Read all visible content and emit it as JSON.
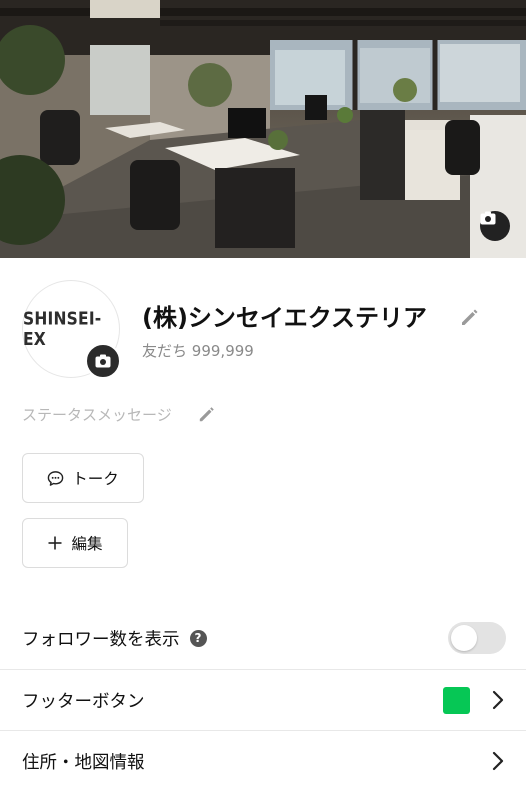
{
  "profile": {
    "name": "(株)シンセイエクステリア",
    "friends_label": "友だち",
    "friends_count": "999,999",
    "logo_text": "SHINSEI-EX",
    "status_placeholder": "ステータスメッセージ"
  },
  "actions": {
    "talk_label": "トーク",
    "edit_label": "編集"
  },
  "settings": {
    "follower_count_label": "フォロワー数を表示",
    "follower_count_enabled": false,
    "footer_button_label": "フッターボタン",
    "footer_button_color": "#06c755",
    "address_map_label": "住所・地図情報"
  },
  "icons": {
    "cover_camera": "camera-icon",
    "avatar_camera": "camera-icon",
    "name_edit": "pencil-icon",
    "status_edit": "pencil-icon",
    "talk": "chat-bubble-icon",
    "edit": "plus-icon",
    "help": "question-circle-icon",
    "chevron": "chevron-right-icon"
  }
}
